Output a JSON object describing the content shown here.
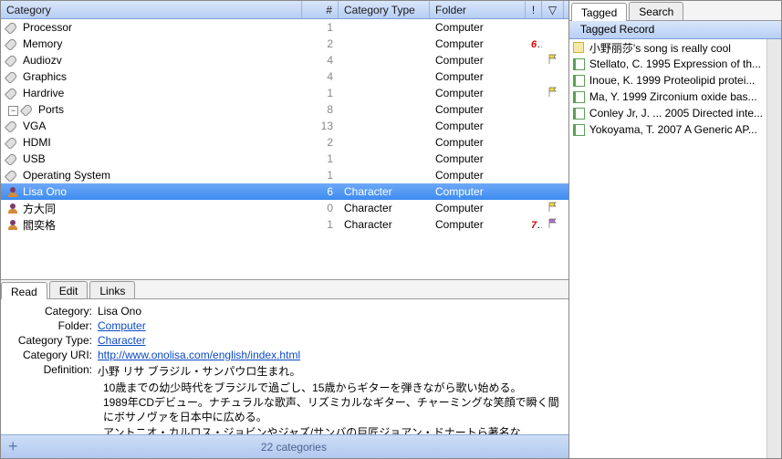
{
  "columns": {
    "category": "Category",
    "count": "#",
    "type": "Category Type",
    "folder": "Folder",
    "excl": "!",
    "filter": "▽"
  },
  "rows": [
    {
      "indent": 1,
      "icon": "tag",
      "name": "Processor",
      "count": 1,
      "type": "",
      "folder": "Computer"
    },
    {
      "indent": 1,
      "icon": "tag",
      "name": "Memory",
      "count": 2,
      "type": "",
      "folder": "Computer",
      "badge": "6",
      "badgeColor": "red"
    },
    {
      "indent": 1,
      "icon": "tag",
      "name": "Audiozv",
      "count": 4,
      "type": "",
      "folder": "Computer",
      "flag": "yellow"
    },
    {
      "indent": 1,
      "icon": "tag",
      "name": "Graphics",
      "count": 4,
      "type": "",
      "folder": "Computer"
    },
    {
      "indent": 1,
      "icon": "tag",
      "name": "Hardrive",
      "count": 1,
      "type": "",
      "folder": "Computer",
      "flag": "yellow"
    },
    {
      "indent": 1,
      "icon": "tag",
      "name": "Ports",
      "count": 8,
      "type": "",
      "folder": "Computer",
      "expandable": true,
      "expanded": true
    },
    {
      "indent": 2,
      "icon": "tag",
      "name": "VGA",
      "count": 13,
      "type": "",
      "folder": "Computer"
    },
    {
      "indent": 2,
      "icon": "tag",
      "name": "HDMI",
      "count": 2,
      "type": "",
      "folder": "Computer"
    },
    {
      "indent": 2,
      "icon": "tag",
      "name": "USB",
      "count": 1,
      "type": "",
      "folder": "Computer"
    },
    {
      "indent": 1,
      "icon": "tag",
      "name": "Operating System",
      "count": 1,
      "type": "",
      "folder": "Computer"
    },
    {
      "indent": 1,
      "icon": "person",
      "name": "Lisa Ono",
      "count": 6,
      "type": "Character",
      "folder": "Computer",
      "selected": true
    },
    {
      "indent": 1,
      "icon": "person",
      "name": "方大同",
      "count": 0,
      "type": "Character",
      "folder": "Computer",
      "flag": "yellow"
    },
    {
      "indent": 1,
      "icon": "person",
      "name": "閻奕格",
      "count": 1,
      "type": "Character",
      "folder": "Computer",
      "badge": "7",
      "badgeColor": "red",
      "flag": "purple"
    }
  ],
  "detailTabs": [
    "Read",
    "Edit",
    "Links"
  ],
  "detailActive": 0,
  "detail": {
    "labels": {
      "category": "Category:",
      "folder": "Folder:",
      "type": "Category Type:",
      "uri": "Category URI:",
      "definition": "Definition:"
    },
    "category": "Lisa Ono",
    "folder": "Computer",
    "type": "Character",
    "uri": "http://www.onolisa.com/english/index.html",
    "definition": [
      "小野 リサ ブラジル・サンパウロ生まれ。",
      "10歳までの幼少時代をブラジルで過ごし、15歳からギターを弾きながら歌い始める。",
      "1989年CDデビュー。ナチュラルな歌声、リズミカルなギター、チャーミングな笑顔で瞬く間にボサノヴァを日本中に広める。",
      "アントニオ・カルロス・ジョビンやジャズ/サンバの巨匠ジョアン・ドナートら著名な"
    ]
  },
  "status": {
    "plus": "+",
    "text": "22  categories"
  },
  "right": {
    "tabs": [
      "Tagged",
      "Search"
    ],
    "active": 0,
    "header": "Tagged Record",
    "items": [
      {
        "icon": "note",
        "text": "小野丽莎's song is really cool"
      },
      {
        "icon": "doc",
        "text": "Stellato, C. 1995  Expression of th..."
      },
      {
        "icon": "doc",
        "text": "Inoue, K. 1999  Proteolipid protei..."
      },
      {
        "icon": "doc",
        "text": "Ma, Y. 1999  Zirconium oxide bas..."
      },
      {
        "icon": "doc",
        "text": "Conley Jr, J. ... 2005  Directed inte..."
      },
      {
        "icon": "doc",
        "text": "Yokoyama, T. 2007  A Generic AP..."
      }
    ]
  }
}
